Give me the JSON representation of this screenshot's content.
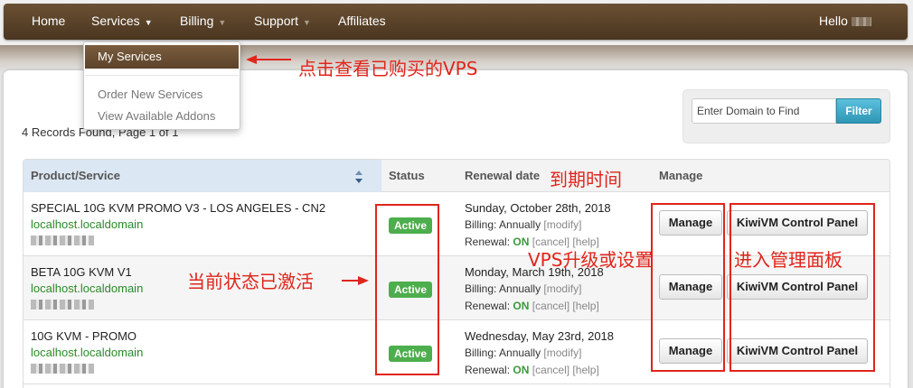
{
  "nav": {
    "home": "Home",
    "services": "Services",
    "billing": "Billing",
    "support": "Support",
    "affiliates": "Affiliates",
    "hello": "Hello"
  },
  "dropdown": {
    "items": [
      "My Services",
      "Order New Services",
      "View Available Addons"
    ]
  },
  "records_text": "4 Records Found, Page 1 of 1",
  "search": {
    "placeholder": "Enter Domain to Find",
    "button": "Filter"
  },
  "table": {
    "headers": [
      "Product/Service",
      "Status",
      "Renewal date",
      "Manage"
    ],
    "rows": [
      {
        "product": "SPECIAL 10G KVM PROMO V3 - LOS ANGELES - CN2",
        "domain": "localhost.localdomain",
        "status": "Active",
        "renewal_date": "Sunday, October 28th, 2018",
        "billing_label": "Billing:",
        "billing_value": "Annually",
        "modify": "modify",
        "renewal_label": "Renewal:",
        "renewal_value": "ON",
        "cancel": "cancel",
        "help": "help",
        "manage_button": "Manage",
        "panel_button": "KiwiVM Control Panel"
      },
      {
        "product": "BETA 10G KVM V1",
        "domain": "localhost.localdomain",
        "status": "Active",
        "renewal_date": "Monday, March 19th, 2018",
        "billing_label": "Billing:",
        "billing_value": "Annually",
        "modify": "modify",
        "renewal_label": "Renewal:",
        "renewal_value": "ON",
        "cancel": "cancel",
        "help": "help",
        "manage_button": "Manage",
        "panel_button": "KiwiVM Control Panel"
      },
      {
        "product": "10G KVM - PROMO",
        "domain": "localhost.localdomain",
        "status": "Active",
        "renewal_date": "Wednesday, May 23rd, 2018",
        "billing_label": "Billing:",
        "billing_value": "Annually",
        "modify": "modify",
        "renewal_label": "Renewal:",
        "renewal_value": "ON",
        "cancel": "cancel",
        "help": "help",
        "manage_button": "Manage",
        "panel_button": "KiwiVM Control Panel"
      }
    ]
  },
  "annotations": {
    "my_services": "点击查看已购买的VPS",
    "renewal": "到期时间",
    "status": "当前状态已激活",
    "manage": "VPS升级或设置",
    "panel": "进入管理面板"
  },
  "colors": {
    "nav_brown": "#5c432a",
    "active_green": "#4cae4c",
    "domain_green": "#2a8a2a",
    "filter_blue": "#2f96b4",
    "annotation_red": "#e0251b"
  }
}
